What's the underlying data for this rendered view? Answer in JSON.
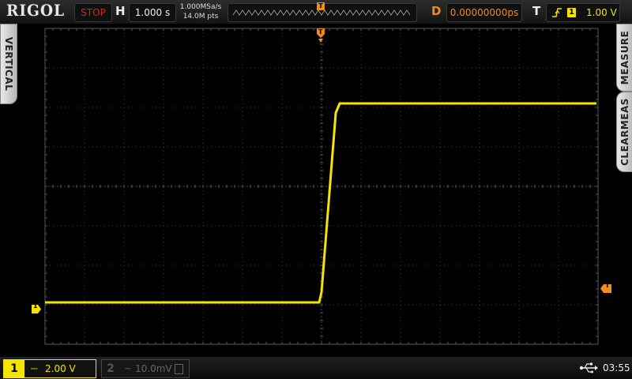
{
  "top": {
    "brand": "RIGOL",
    "run_state": "STOP",
    "horizontal_label": "H",
    "timebase": "1.000 s",
    "sample_rate": "1.000MSa/s",
    "memory_depth": "14.0M pts",
    "memory_trigger_marker": "T",
    "delay_label": "D",
    "delay_value": "0.00000000ps",
    "trigger_label": "T",
    "trigger_source": "1",
    "trigger_level": "1.00 V",
    "trigger_edge_icon": "rising-edge-icon"
  },
  "side": {
    "vertical": "VERTICAL",
    "measure": "MEASURE",
    "clear_meas": "CLEARMEAS"
  },
  "markers": {
    "ch1_offset": "1",
    "trigger_level_marker": "T",
    "trigger_position_marker": "T"
  },
  "bottom": {
    "ch1": {
      "number": "1",
      "coupling": "⎓",
      "scale": "2.00 V"
    },
    "ch2": {
      "number": "2",
      "coupling": "~",
      "scale": "10.0mV"
    },
    "usb_icon": "usb-icon",
    "time": "03:55"
  },
  "colors": {
    "ch1": "#f5e400",
    "trigger": "#f28c1b",
    "stop": "#e02020",
    "grid": "#3c3c3c"
  }
}
